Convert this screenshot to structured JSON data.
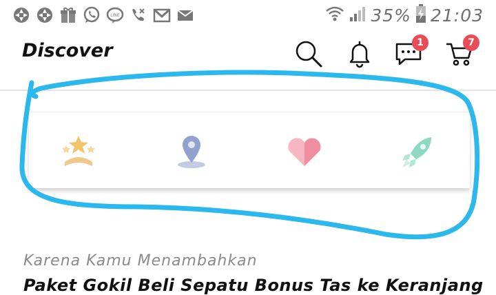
{
  "status_bar": {
    "notification_icons": [
      "aperture-icon",
      "aperture-icon",
      "gift-icon",
      "whatsapp-icon",
      "line-icon",
      "missed-call-icon",
      "gmail-icon",
      "mail-icon"
    ],
    "battery": "35%",
    "time": "21:03"
  },
  "header": {
    "title": "Discover",
    "chat_badge": "1",
    "cart_badge": "7"
  },
  "categories": [
    {
      "icon": "stars-icon",
      "color": "#f3c36b"
    },
    {
      "icon": "location-pin-icon",
      "color": "#8fa3cc"
    },
    {
      "icon": "heart-icon",
      "color": "#ef8ea0"
    },
    {
      "icon": "rocket-icon",
      "color": "#8fd8c1"
    }
  ],
  "section": {
    "label": "Karena Kamu Menambahkan",
    "title": "Paket Gokil Beli Sepatu Bonus Tas  ke Keranjang"
  },
  "annotation_color": "#2bb8ec"
}
